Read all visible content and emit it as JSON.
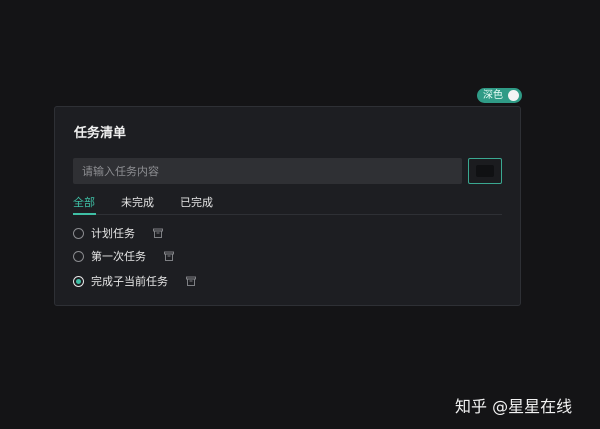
{
  "theme_toggle": {
    "label": "深色"
  },
  "card": {
    "title": "任务清单",
    "input": {
      "placeholder": "请输入任务内容",
      "value": ""
    },
    "add_button": {
      "icon": "add-icon"
    },
    "tabs": [
      {
        "label": "全部",
        "active": true
      },
      {
        "label": "未完成",
        "active": false
      },
      {
        "label": "已完成",
        "active": false
      }
    ],
    "tasks": [
      {
        "label": "计划任务",
        "completed": false
      },
      {
        "label": "第一次任务",
        "completed": false
      },
      {
        "label": "完成子当前任务",
        "completed": true
      }
    ]
  },
  "watermark": "知乎 @星星在线",
  "colors": {
    "background": "#141416",
    "card": "#1d1e22",
    "accent": "#3fbfa5",
    "toggle": "#2f9b86"
  }
}
